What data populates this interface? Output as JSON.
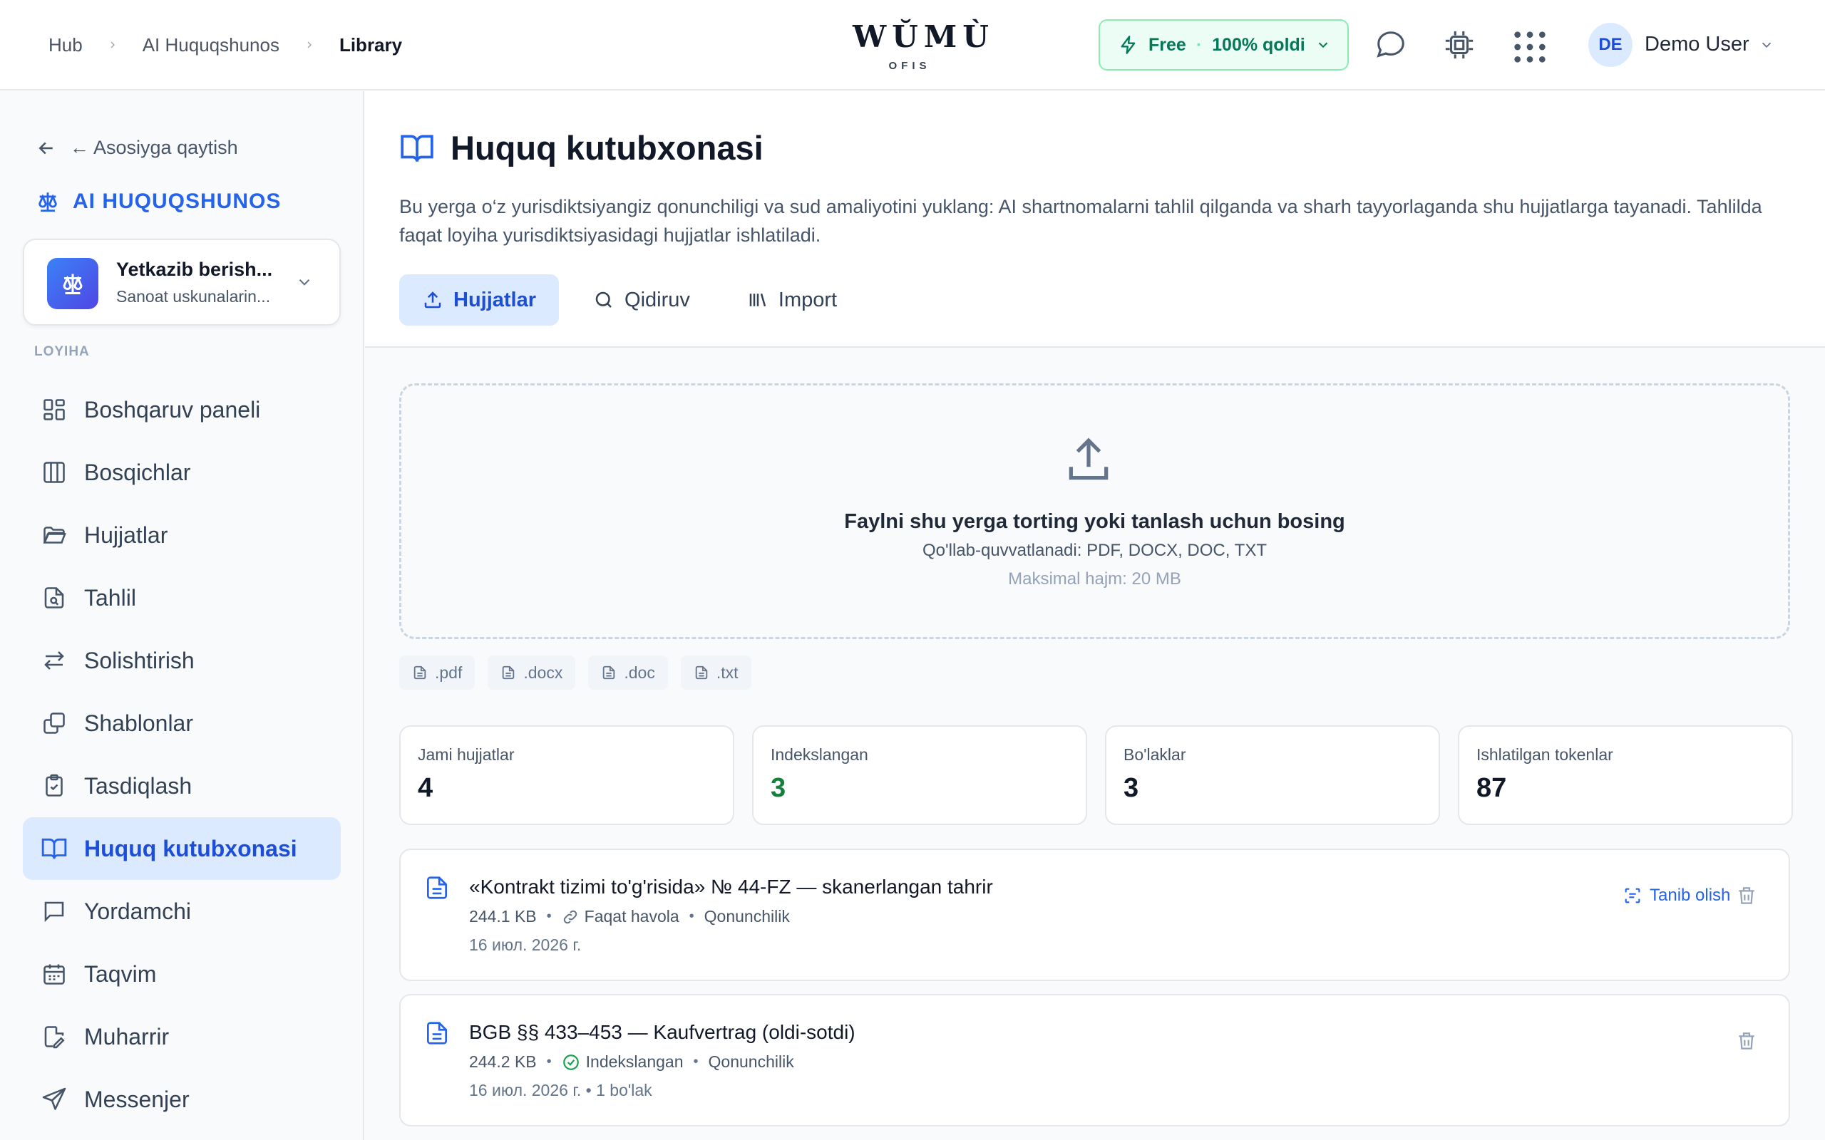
{
  "header": {
    "breadcrumb": [
      "Hub",
      "AI Huquqshunos",
      "Library"
    ],
    "logo_main": "WŬMÙ",
    "logo_sub": "OFIS",
    "plan": {
      "name": "Free",
      "quota": "100% qoldi"
    },
    "user": {
      "initials": "DE",
      "name": "Demo User"
    }
  },
  "sidebar": {
    "back_label": "← Asosiyga qaytish",
    "brand": "AI HUQUQSHUNOS",
    "project": {
      "title": "Yetkazib berish...",
      "subtitle": "Sanoat uskunalarin..."
    },
    "section_label": "LOYIHA",
    "items": [
      {
        "label": "Boshqaruv paneli",
        "icon": "dashboard-icon"
      },
      {
        "label": "Bosqichlar",
        "icon": "columns-icon"
      },
      {
        "label": "Hujjatlar",
        "icon": "folder-icon"
      },
      {
        "label": "Tahlil",
        "icon": "file-search-icon"
      },
      {
        "label": "Solishtirish",
        "icon": "arrows-swap-icon"
      },
      {
        "label": "Shablonlar",
        "icon": "copy-icon"
      },
      {
        "label": "Tasdiqlash",
        "icon": "clipboard-check-icon"
      },
      {
        "label": "Huquq kutubxonasi",
        "icon": "book-icon",
        "active": true
      },
      {
        "label": "Yordamchi",
        "icon": "chat-icon"
      },
      {
        "label": "Taqvim",
        "icon": "calendar-icon"
      },
      {
        "label": "Muharrir",
        "icon": "file-edit-icon"
      },
      {
        "label": "Messenjer",
        "icon": "send-icon"
      }
    ]
  },
  "main": {
    "title": "Huquq kutubxonasi",
    "description": "Bu yerga o‘z yurisdiktsiyangiz qonunchiligi va sud amaliyotini yuklang: AI shartnomalarni tahlil qilganda va sharh tayyorlaganda shu hujjatlarga tayanadi. Tahlilda faqat loyiha yurisdiktsiyasidagi hujjatlar ishlatiladi.",
    "tabs": [
      "Hujjatlar",
      "Qidiruv",
      "Import"
    ],
    "dropzone": {
      "title": "Faylni shu yerga torting yoki tanlash uchun bosing",
      "supported": "Qo'llab-quvvatlanadi: PDF, DOCX, DOC, TXT",
      "max_size": "Maksimal hajm: 20 MB"
    },
    "formats": [
      ".pdf",
      ".docx",
      ".doc",
      ".txt"
    ],
    "stats": [
      {
        "label": "Jami hujjatlar",
        "value": "4"
      },
      {
        "label": "Indekslangan",
        "value": "3"
      },
      {
        "label": "Bo'laklar",
        "value": "3"
      },
      {
        "label": "Ishlatilgan tokenlar",
        "value": "87"
      }
    ],
    "documents": [
      {
        "title": "«Kontrakt tizimi to'g'risida» № 44-FZ — skanerlangan tahrir",
        "size": "244.1 KB",
        "status": "Faqat havola",
        "category": "Qonunchilik",
        "date": "16 июл. 2026 г.",
        "action": "Tanib olish"
      },
      {
        "title": "BGB §§ 433–453 — Kaufvertrag (oldi-sotdi)",
        "size": "244.2 KB",
        "status": "Indekslangan",
        "category": "Qonunchilik",
        "date": "16 июл. 2026 г. • 1 bo'lak"
      }
    ]
  }
}
